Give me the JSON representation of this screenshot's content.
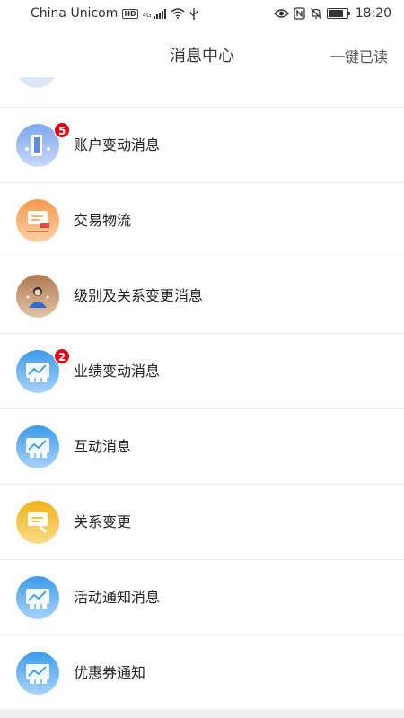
{
  "status_bar": {
    "carrier": "China Unicom",
    "hd": "HD",
    "network": "4G",
    "battery_level": 0.8,
    "time": "18:20",
    "icons": [
      "hd-icon",
      "signal-icon",
      "wifi-icon",
      "usb-icon",
      "eye-icon",
      "nfc-icon",
      "mute-icon",
      "battery-icon"
    ]
  },
  "nav": {
    "title": "消息中心",
    "mark_all_read": "一键已读"
  },
  "messages": [
    {
      "label": "账户变动消息",
      "badge": "5",
      "icon": "account-change-icon",
      "colors": [
        "#7ea7ef",
        "#c9d8fb"
      ]
    },
    {
      "label": "交易物流",
      "badge": "",
      "icon": "trade-logistics-icon",
      "colors": [
        "#f59a4c",
        "#fbd0a7"
      ]
    },
    {
      "label": "级别及关系变更消息",
      "badge": "",
      "icon": "level-relation-icon",
      "colors": [
        "#b07a4f",
        "#e3c4a6"
      ]
    },
    {
      "label": "业绩变动消息",
      "badge": "2",
      "icon": "performance-icon",
      "colors": [
        "#3d9be9",
        "#a7d3fb"
      ]
    },
    {
      "label": "互动消息",
      "badge": "",
      "icon": "interaction-icon",
      "colors": [
        "#3d9be9",
        "#a7d3fb"
      ]
    },
    {
      "label": "关系变更",
      "badge": "",
      "icon": "relation-change-icon",
      "colors": [
        "#f0b21d",
        "#f9dc8b"
      ]
    },
    {
      "label": "活动通知消息",
      "badge": "",
      "icon": "activity-notice-icon",
      "colors": [
        "#3d9be9",
        "#a7d3fb"
      ]
    },
    {
      "label": "优惠券通知",
      "badge": "",
      "icon": "coupon-notice-icon",
      "colors": [
        "#3d9be9",
        "#a7d3fb"
      ]
    }
  ]
}
